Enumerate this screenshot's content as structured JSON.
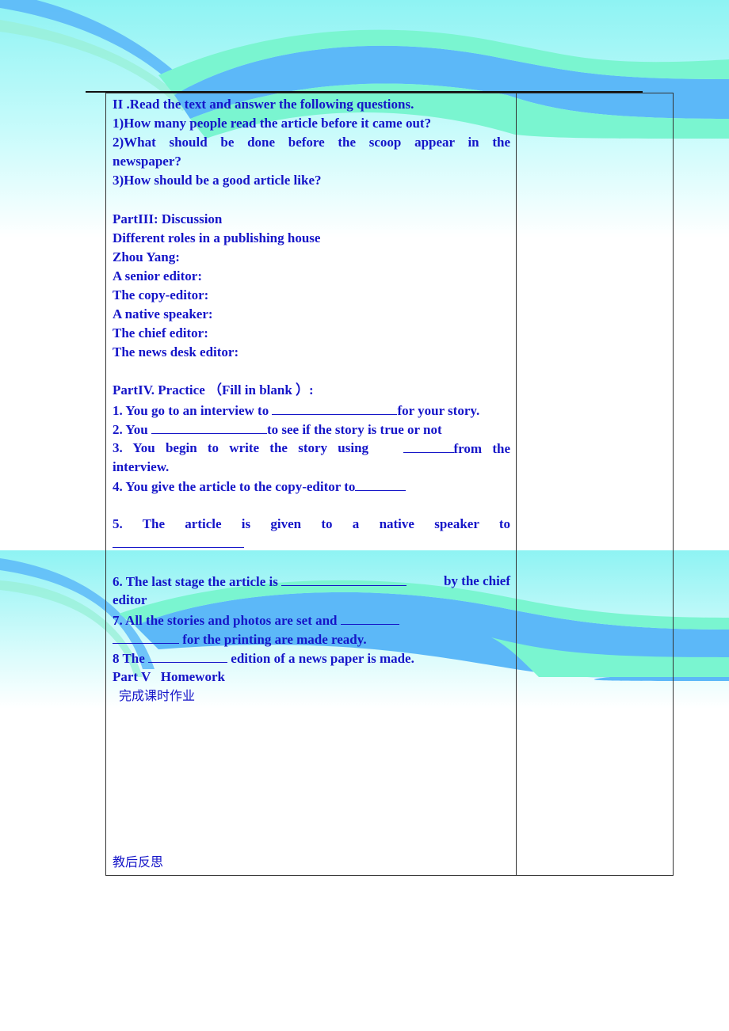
{
  "colors": {
    "text": "#1515c8",
    "border": "#333333",
    "bg_cyan": "#8cf5f5",
    "bg_blue": "#5cb8f8",
    "bg_green": "#7af5d0"
  },
  "section2": {
    "heading": "II .Read the text and answer the following questions.",
    "questions": [
      "1)How many people read the article before it came out?",
      "2)What should be done before the scoop appear in the",
      "newspaper?",
      "3)How should be a good article like?"
    ]
  },
  "section3": {
    "heading": "PartIII: Discussion",
    "subtitle": "Different roles in a publishing house",
    "roles": [
      "Zhou Yang:",
      "A senior editor:",
      "The copy-editor:",
      "A native speaker:",
      "The chief editor:",
      "The news desk editor:"
    ]
  },
  "section4": {
    "heading": "PartIV. Practice （Fill in blank ）:",
    "items": {
      "i1_a": "1. You go to an interview to",
      "i1_b": "for your story.",
      "i2_a": "2. You",
      "i2_b": "to see if the story is true or not",
      "i3_a": "3. You begin to write the story using",
      "i3_b": "from the",
      "i3_c": "interview.",
      "i4_a": "4. You give the article to the copy-editor to",
      "i5_a": "5. The article is given to a native speaker to",
      "i6_a": "6. The last stage the article is",
      "i6_b": "by the chief",
      "i6_c": "editor",
      "i7_a": "7. All the stories and photos are set and",
      "i7_b": "for the printing are made ready.",
      "i8_a": "8 The",
      "i8_b": "edition of a news paper is made."
    }
  },
  "section5": {
    "heading": "Part V   Homework",
    "task": "完成课时作业"
  },
  "reflection_label": "教后反思"
}
